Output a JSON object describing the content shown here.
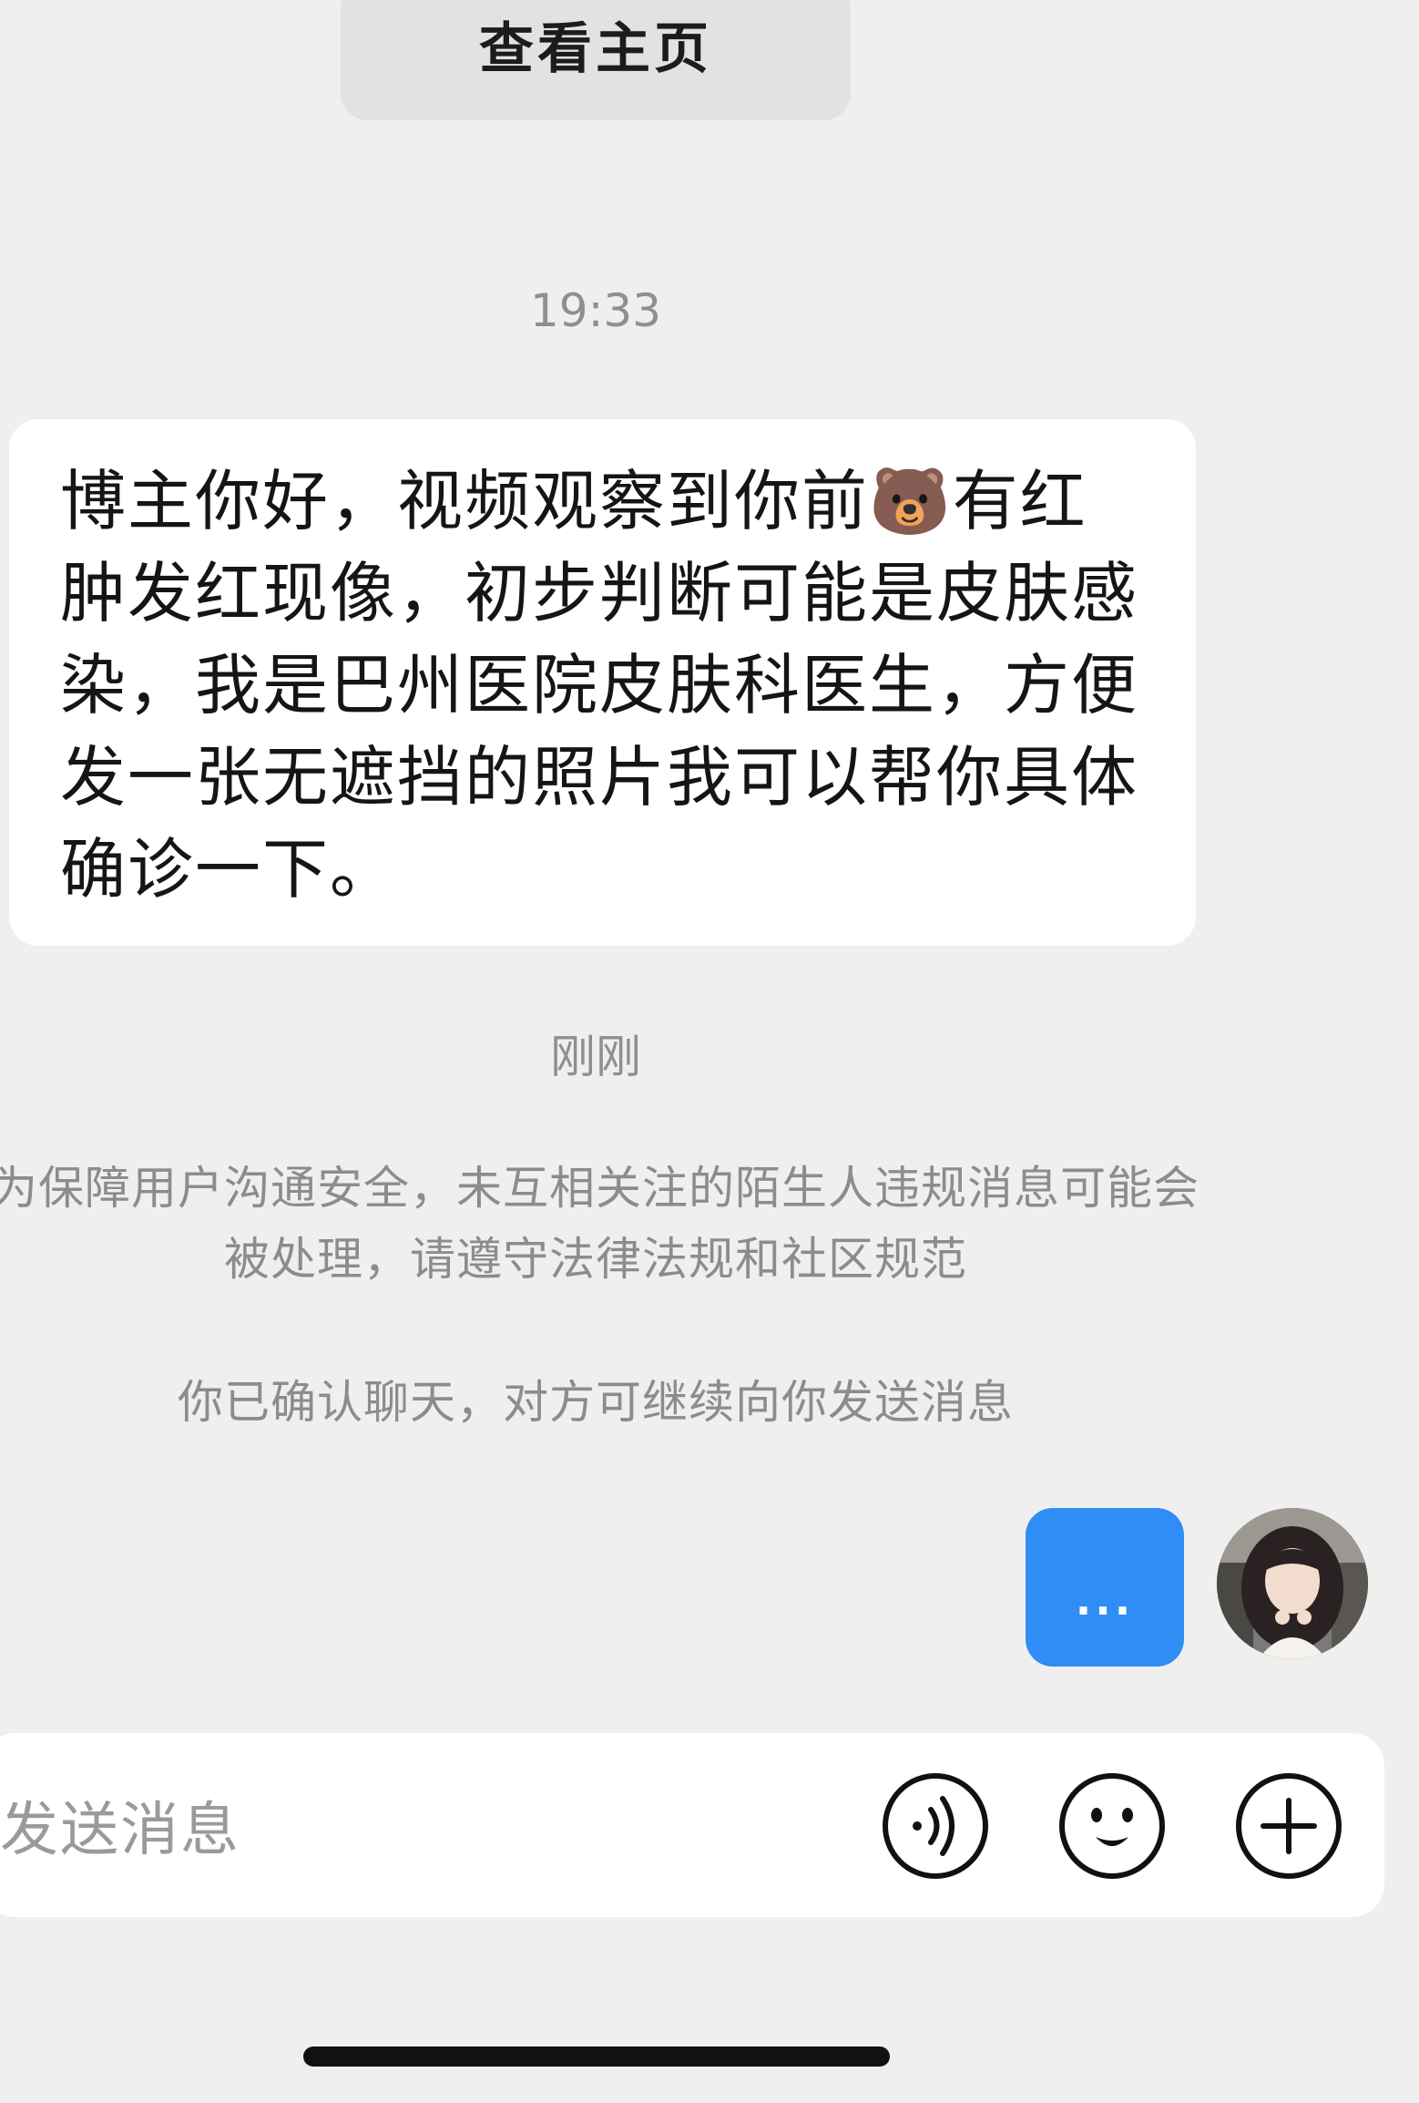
{
  "header": {
    "view_profile_label": "查看主页"
  },
  "messages": {
    "timestamp_1": "19:33",
    "incoming_text": "博主你好，视频观察到你前🐻有红肿发红现像，初步判断可能是皮肤感染，我是巴州医院皮肤科医生，方便发一张无遮挡的照片我可以帮你具体确诊一下。",
    "timestamp_2": "刚刚",
    "notice_1": "为保障用户沟通安全，未互相关注的陌生人违规消息可能会被处理，请遵守法律法规和社区规范",
    "notice_2": "你已确认聊天，对方可继续向你发送消息",
    "outgoing_text": "..."
  },
  "composer": {
    "placeholder": "发送消息",
    "icons": [
      "voice-icon",
      "emoji-icon",
      "plus-icon"
    ]
  },
  "colors": {
    "background": "#efefef",
    "bubble_incoming": "#ffffff",
    "bubble_outgoing": "#2f8df5",
    "muted_text": "#8c8c8c"
  }
}
